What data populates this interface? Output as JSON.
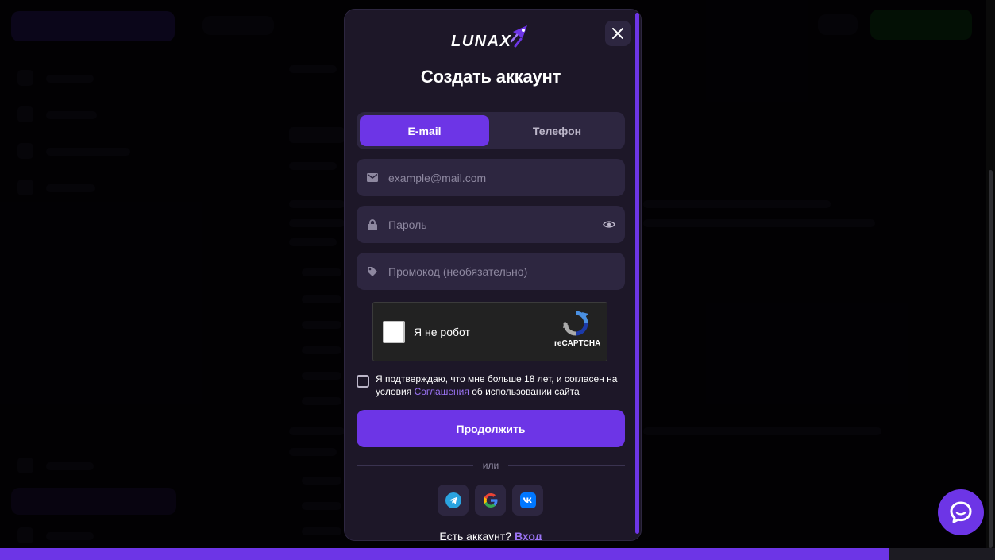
{
  "modal": {
    "brand": "LUNAX",
    "title": "Создать аккаунт",
    "tabs": [
      {
        "label": "E-mail",
        "active": true
      },
      {
        "label": "Телефон",
        "active": false
      }
    ],
    "email": {
      "placeholder": "example@mail.com",
      "value": "",
      "icon": "mail-icon"
    },
    "password": {
      "placeholder": "Пароль",
      "value": "",
      "icon": "lock-icon",
      "toggle_icon": "eye-icon"
    },
    "promo": {
      "placeholder": "Промокод (необязательно)",
      "value": "",
      "icon": "tag-icon"
    },
    "captcha": {
      "label": "Я не робот",
      "brand": "reCAPTCHA"
    },
    "agree": {
      "text_before": "Я подтверждаю, что мне больше 18 лет, и согласен на условия ",
      "link": "Соглашения",
      "text_after": " об использовании сайта"
    },
    "continue_label": "Продолжить",
    "divider_label": "или",
    "socials": [
      "telegram-icon",
      "google-icon",
      "vk-icon"
    ],
    "have_account": "Есть аккаунт?",
    "login_link": "Вход"
  },
  "page_progress_percent": 89.3,
  "colors": {
    "accent": "#6d35e6",
    "modal_bg": "#1d1728",
    "field_bg": "#2d2640",
    "link": "#9b74f5"
  }
}
